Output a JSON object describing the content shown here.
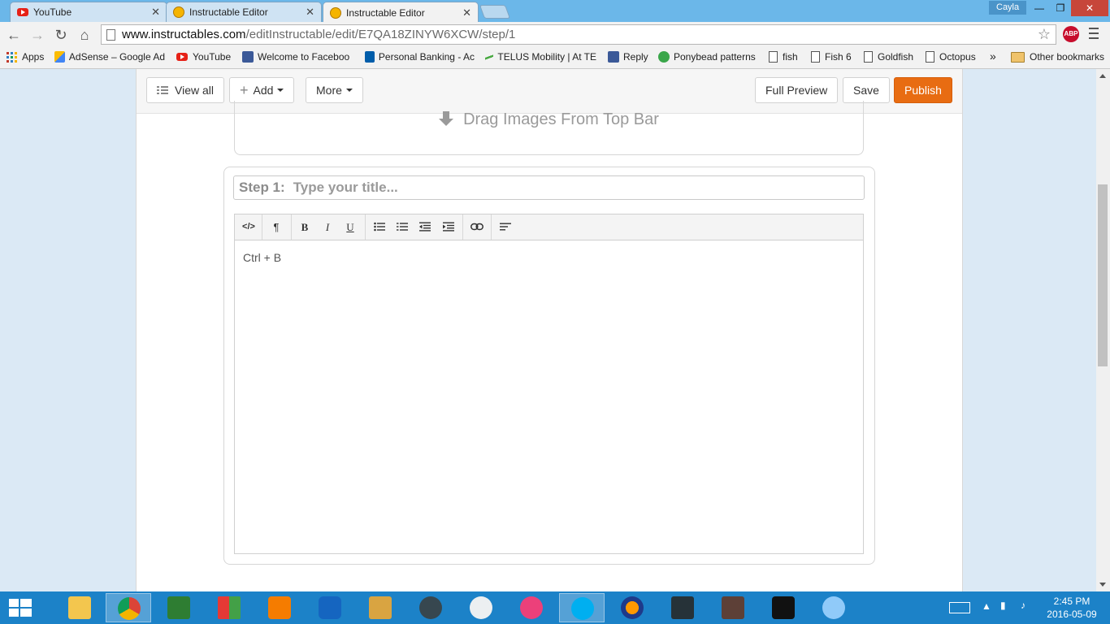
{
  "browser": {
    "tabs": [
      {
        "title": "YouTube",
        "icon": "youtube-icon",
        "active": false
      },
      {
        "title": "Instructable Editor",
        "icon": "instructables-robot-icon",
        "active": false
      },
      {
        "title": "Instructable Editor",
        "icon": "instructables-robot-icon",
        "active": true
      }
    ],
    "profile_name": "Cayla",
    "url_host": "www.instructables.com",
    "url_path": "/editInstructable/edit/E7QA18ZINYW6XCW/step/1",
    "abp_label": "ABP",
    "bookmarks": [
      {
        "label": "Apps",
        "icon": "apps-grid-icon"
      },
      {
        "label": "AdSense – Google Ad",
        "icon": "adsense-icon"
      },
      {
        "label": "YouTube",
        "icon": "youtube-icon"
      },
      {
        "label": "Welcome to Faceboo",
        "icon": "facebook-icon"
      },
      {
        "label": "Personal Banking - Ac",
        "icon": "rbc-icon"
      },
      {
        "label": "TELUS Mobility | At TE",
        "icon": "telus-icon"
      },
      {
        "label": "Reply",
        "icon": "facebook-icon"
      },
      {
        "label": "Ponybead patterns",
        "icon": "green-circle-icon"
      },
      {
        "label": "fish",
        "icon": "document-icon"
      },
      {
        "label": "Fish 6",
        "icon": "document-icon"
      },
      {
        "label": "Goldfish",
        "icon": "document-icon"
      },
      {
        "label": "Octopus",
        "icon": "document-icon"
      }
    ],
    "bookmarks_overflow": "»",
    "other_bookmarks": "Other bookmarks"
  },
  "editor": {
    "view_all_label": "View all",
    "add_label": "Add",
    "more_label": "More",
    "full_preview_label": "Full Preview",
    "save_label": "Save",
    "publish_label": "Publish",
    "drop_text": "Drag Images From Top Bar",
    "step_label": "Step 1:",
    "step_title_placeholder": "Type your title...",
    "rte_tools": [
      "</>",
      "¶",
      "B",
      "I",
      "U"
    ],
    "body_text": "Ctrl + B"
  },
  "taskbar": {
    "time": "2:45 PM",
    "date": "2016-05-09"
  },
  "colors": {
    "publish": "#e86c12",
    "chrome_frame": "#6bb7e9",
    "taskbar": "#1c82c8",
    "page_bg": "#dbe9f5"
  }
}
